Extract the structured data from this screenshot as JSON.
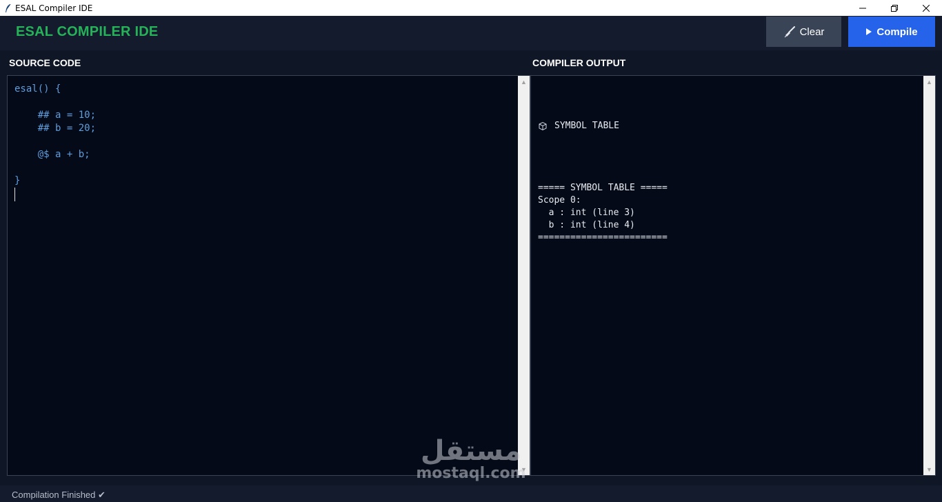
{
  "window": {
    "title": "ESAL Compiler IDE",
    "controls": [
      "minimize",
      "restore",
      "close"
    ]
  },
  "header": {
    "title": "ESAL COMPILER IDE",
    "title_color": "#27b25a",
    "clear_label": "Clear",
    "compile_label": "Compile",
    "compile_color": "#2563eb"
  },
  "source": {
    "label": "SOURCE CODE",
    "code": "esal() {\n\n    ## a = 10;\n    ## b = 20;\n\n    @$ a + b;\n\n}"
  },
  "output": {
    "label": "COMPILER OUTPUT",
    "heading": "SYMBOL TABLE",
    "text": "===== SYMBOL TABLE =====\nScope 0:\n  a : int (line 3)\n  b : int (line 4)\n========================"
  },
  "watermark": {
    "arabic": "مستقل",
    "latin": "mostaql.com"
  },
  "status": {
    "text": "Compilation Finished ✔"
  }
}
